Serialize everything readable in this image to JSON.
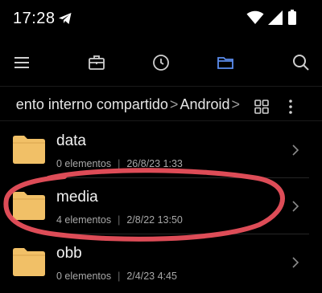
{
  "status_bar": {
    "time": "17:28",
    "icons": [
      "telegram-icon",
      "wifi-icon",
      "signal-icon",
      "battery-icon"
    ]
  },
  "toolbar": {
    "icons": [
      "menu-icon",
      "briefcase-icon",
      "clock-icon",
      "folder-icon",
      "search-icon"
    ],
    "active": "folder-icon",
    "accent_color": "#5b8def"
  },
  "breadcrumb": {
    "items": [
      "Almacenamiento interno compartido",
      "Android"
    ],
    "visible_text": "ento interno compartido",
    "current": "Android",
    "separator": ">"
  },
  "files": [
    {
      "name": "data",
      "count": "0 elementos",
      "date": "26/8/23 1:33"
    },
    {
      "name": "media",
      "count": "4 elementos",
      "date": "2/8/22 13:50"
    },
    {
      "name": "obb",
      "count": "0 elementos",
      "date": "2/4/23 4:45"
    }
  ],
  "colors": {
    "background": "#000000",
    "folder": "#f1c067",
    "annotation": "#f0525e"
  }
}
